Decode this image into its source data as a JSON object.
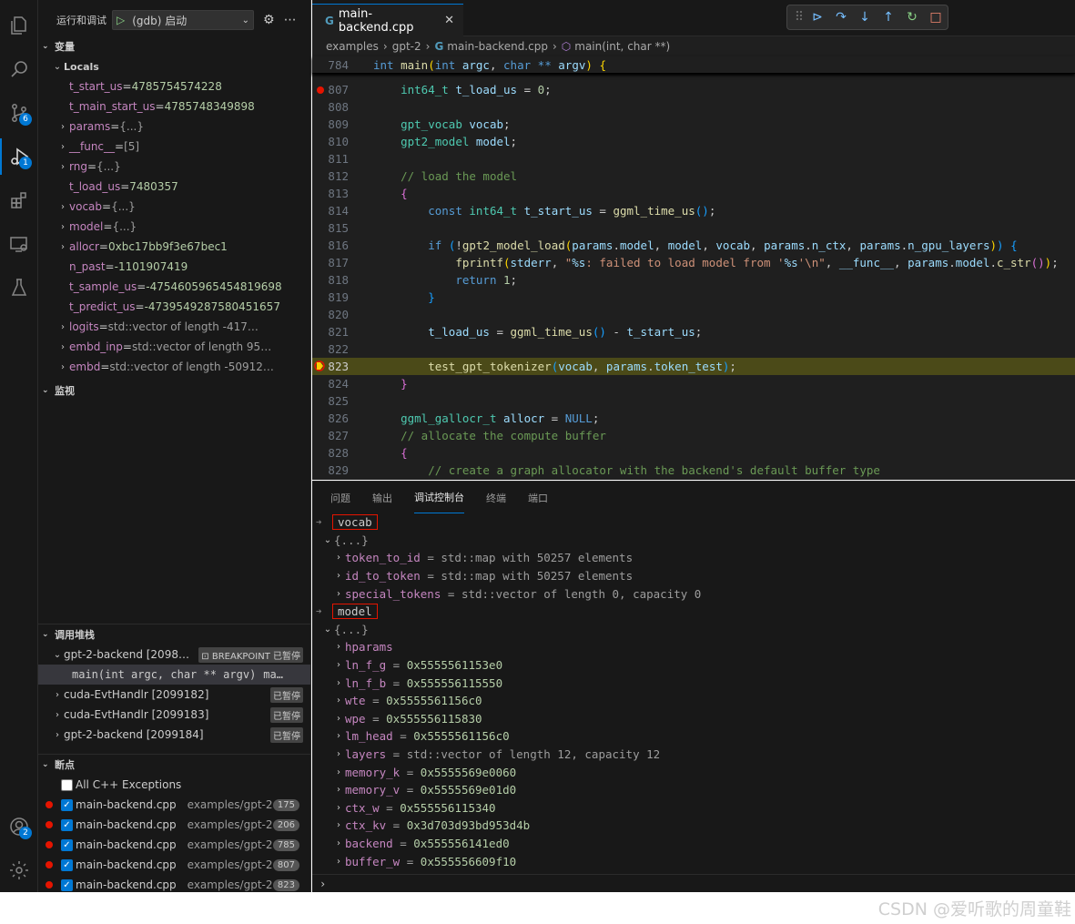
{
  "activity_bar": {
    "scm_badge": "6",
    "debug_badge": "1",
    "accounts_badge": "2"
  },
  "run_and_debug": {
    "title": "运行和调试",
    "config": "(gdb) 启动"
  },
  "variables": {
    "title": "变量",
    "locals_title": "Locals",
    "items": [
      {
        "name": "t_start_us",
        "value": "4785754574228",
        "kind": "num",
        "expandable": false
      },
      {
        "name": "t_main_start_us",
        "value": "4785748349898",
        "kind": "num",
        "expandable": false
      },
      {
        "name": "params",
        "value": "{...}",
        "kind": "str",
        "expandable": true
      },
      {
        "name": "__func__",
        "value": "[5]",
        "kind": "str",
        "expandable": true
      },
      {
        "name": "rng",
        "value": "{...}",
        "kind": "str",
        "expandable": true
      },
      {
        "name": "t_load_us",
        "value": "7480357",
        "kind": "num",
        "expandable": false
      },
      {
        "name": "vocab",
        "value": "{...}",
        "kind": "str",
        "expandable": true
      },
      {
        "name": "model",
        "value": "{...}",
        "kind": "str",
        "expandable": true
      },
      {
        "name": "allocr",
        "value": "0xbc17bb9f3e67bec1",
        "kind": "num",
        "expandable": true
      },
      {
        "name": "n_past",
        "value": "-1101907419",
        "kind": "num",
        "expandable": false
      },
      {
        "name": "t_sample_us",
        "value": "-4754605965454819698",
        "kind": "num",
        "expandable": false
      },
      {
        "name": "t_predict_us",
        "value": "-4739549287580451657",
        "kind": "num",
        "expandable": false
      },
      {
        "name": "logits",
        "value": "std::vector of length -417…",
        "kind": "str",
        "expandable": true
      },
      {
        "name": "embd_inp",
        "value": "std::vector of length 95…",
        "kind": "str",
        "expandable": true
      },
      {
        "name": "embd",
        "value": "std::vector of length -50912…",
        "kind": "str",
        "expandable": true
      }
    ]
  },
  "watch": {
    "title": "监视"
  },
  "call_stack": {
    "title": "调用堆栈",
    "threads": [
      {
        "name": "gpt-2-backend [2098…",
        "status": "⊡ BREAKPOINT 已暂停",
        "expanded": true
      },
      {
        "name": "cuda-EvtHandlr [2099182]",
        "status": "已暂停",
        "expanded": false
      },
      {
        "name": "cuda-EvtHandlr [2099183]",
        "status": "已暂停",
        "expanded": false
      },
      {
        "name": "gpt-2-backend [2099184]",
        "status": "已暂停",
        "expanded": false
      }
    ],
    "frame": "main(int argc, char ** argv)",
    "frame_suffix": "ma…"
  },
  "breakpoints": {
    "title": "断点",
    "exceptions": "All C++ Exceptions",
    "items": [
      {
        "file": "main-backend.cpp",
        "dir": "examples/gpt-2",
        "line": "175"
      },
      {
        "file": "main-backend.cpp",
        "dir": "examples/gpt-2",
        "line": "206"
      },
      {
        "file": "main-backend.cpp",
        "dir": "examples/gpt-2",
        "line": "785"
      },
      {
        "file": "main-backend.cpp",
        "dir": "examples/gpt-2",
        "line": "807"
      },
      {
        "file": "main-backend.cpp",
        "dir": "examples/gpt-2",
        "line": "823"
      }
    ]
  },
  "editor": {
    "tab_label": "main-backend.cpp",
    "breadcrumb": [
      "examples",
      "gpt-2",
      "main-backend.cpp",
      "main(int, char **)"
    ],
    "sticky_line": "784"
  },
  "panel": {
    "tabs": [
      "问题",
      "输出",
      "调试控制台",
      "终端",
      "端口"
    ],
    "active_tab": "调试控制台",
    "expr1": "vocab",
    "expr1_result": "{...}",
    "vocab_children": [
      {
        "name": "token_to_id",
        "value": "std::map with 50257 elements"
      },
      {
        "name": "id_to_token",
        "value": "std::map with 50257 elements"
      },
      {
        "name": "special_tokens",
        "value": "std::vector of length 0, capacity 0"
      }
    ],
    "expr2": "model",
    "expr2_result": "{...}",
    "model_children": [
      {
        "name": "hparams",
        "value": ""
      },
      {
        "name": "ln_f_g",
        "value": "0x5555561153e0"
      },
      {
        "name": "ln_f_b",
        "value": "0x555556115550"
      },
      {
        "name": "wte",
        "value": "0x5555561156c0"
      },
      {
        "name": "wpe",
        "value": "0x555556115830"
      },
      {
        "name": "lm_head",
        "value": "0x5555561156c0"
      },
      {
        "name": "layers",
        "value": "std::vector of length 12, capacity 12"
      },
      {
        "name": "memory_k",
        "value": "0x5555569e0060"
      },
      {
        "name": "memory_v",
        "value": "0x5555569e01d0"
      },
      {
        "name": "ctx_w",
        "value": "0x555556115340"
      },
      {
        "name": "ctx_kv",
        "value": "0x3d703d93bd953d4b"
      },
      {
        "name": "backend",
        "value": "0x555556141ed0"
      },
      {
        "name": "buffer_w",
        "value": "0x555556609f10"
      }
    ]
  },
  "watermark": "CSDN @爱听歌的周童鞋"
}
